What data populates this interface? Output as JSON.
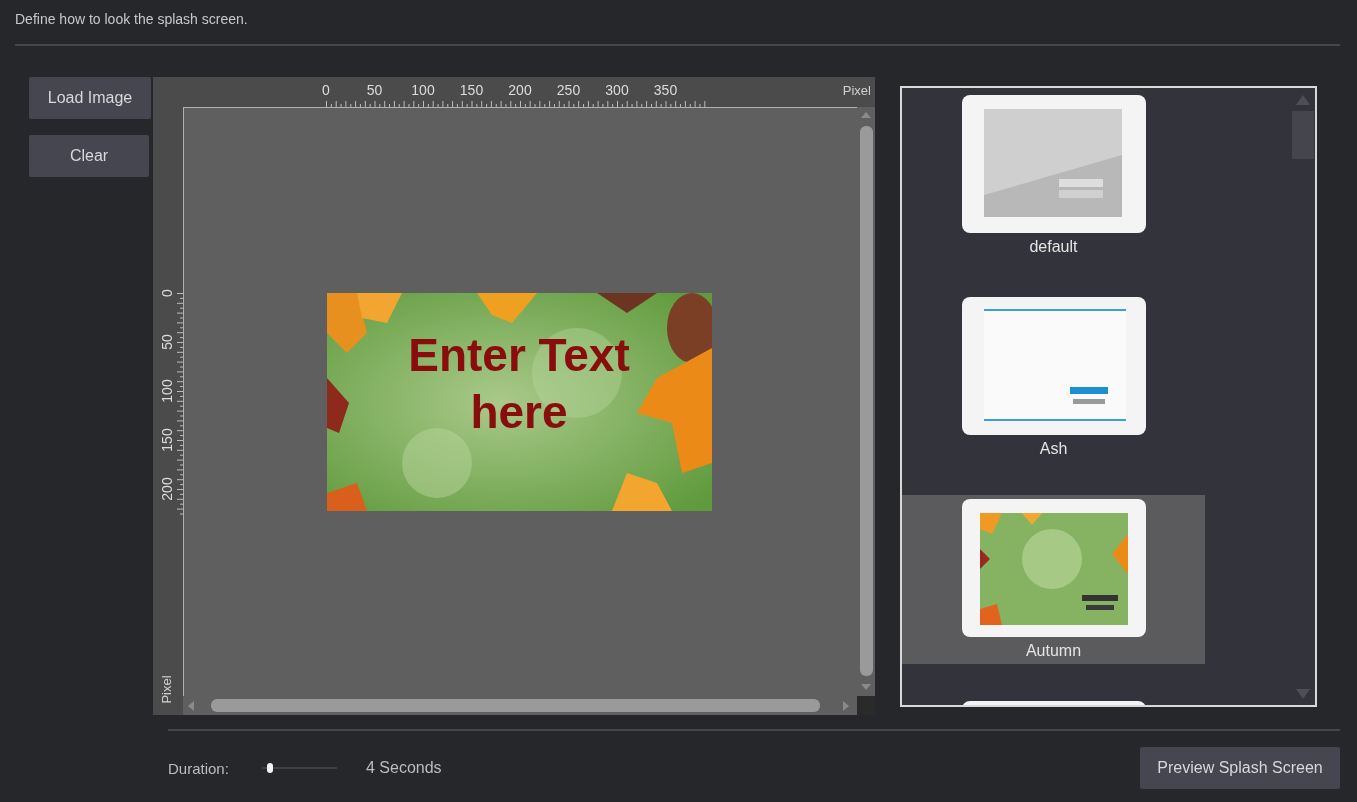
{
  "header": {
    "text": "Define how to look the splash screen."
  },
  "actions": [
    {
      "label": "Load Image"
    },
    {
      "label": "Clear"
    }
  ],
  "editor": {
    "ruler_top": {
      "labels": [
        "0",
        "50",
        "100",
        "150",
        "200",
        "250",
        "300",
        "350"
      ],
      "unit": "Pixel"
    },
    "ruler_left": {
      "labels": [
        "0",
        "50",
        "100",
        "150",
        "200"
      ],
      "unit": "Pixel"
    },
    "splash_text": "Enter Text here"
  },
  "templates": [
    {
      "name": "default",
      "selected": false
    },
    {
      "name": "Ash",
      "selected": false
    },
    {
      "name": "Autumn",
      "selected": true
    },
    {
      "selected": false
    }
  ],
  "duration": {
    "label": "Duration:",
    "level": 0.1,
    "reading": "4 Seconds"
  },
  "preview_button": "Preview Splash Screen"
}
